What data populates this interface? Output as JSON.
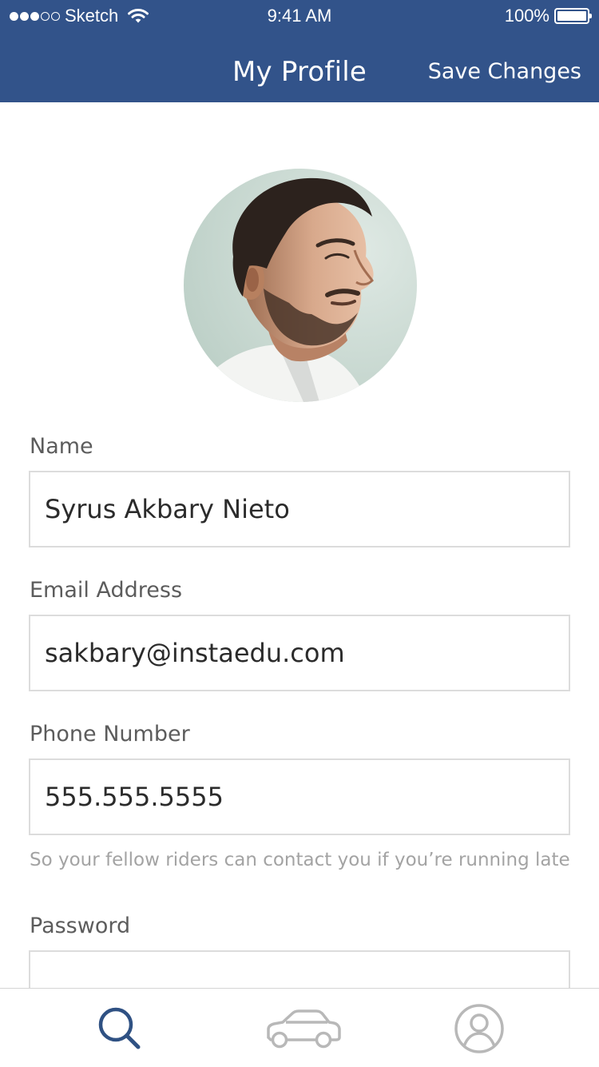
{
  "status_bar": {
    "carrier": "Sketch",
    "time": "9:41 AM",
    "battery": "100%",
    "signal_bars_filled": 3,
    "signal_bars_total": 5,
    "battery_level": 1.0
  },
  "nav": {
    "title": "My Profile",
    "action_label": "Save Changes"
  },
  "profile": {
    "avatar_icon": "profile-photo"
  },
  "form": {
    "name": {
      "label": "Name",
      "value": "Syrus Akbary Nieto"
    },
    "email": {
      "label": "Email Address",
      "value": "sakbary@instaedu.com"
    },
    "phone": {
      "label": "Phone Number",
      "value": "555.555.5555",
      "hint": "So your fellow riders can contact you if you’re running late"
    },
    "password": {
      "label": "Password",
      "value": ""
    }
  },
  "tab_bar": {
    "items": [
      {
        "icon": "search-icon",
        "active": true
      },
      {
        "icon": "car-icon",
        "active": false
      },
      {
        "icon": "profile-icon",
        "active": false
      }
    ]
  },
  "colors": {
    "header_bg": "#32538a",
    "header_text": "#ffffff",
    "active_tab": "#2f5183",
    "inactive_tab": "#b8b8b8",
    "label_text": "#5c5c5c",
    "hint_text": "#a3a3a3",
    "field_border": "#dcdcdc"
  }
}
